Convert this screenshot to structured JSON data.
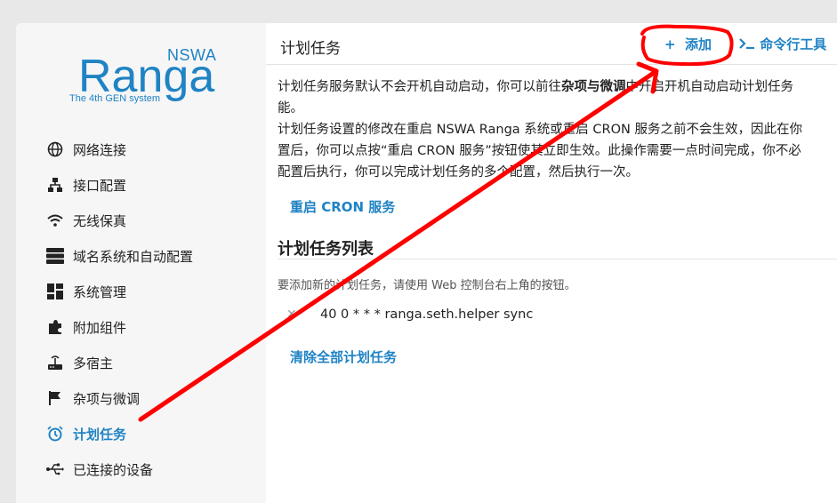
{
  "brand": {
    "name": "Ranga",
    "prefix": "NSWA",
    "tagline": "The 4th GEN system"
  },
  "sidebar": {
    "items": [
      {
        "label": "网络连接",
        "icon": "globe-icon"
      },
      {
        "label": "接口配置",
        "icon": "network-icon"
      },
      {
        "label": "无线保真",
        "icon": "wifi-icon"
      },
      {
        "label": "域名系统和自动配置",
        "icon": "server-icon"
      },
      {
        "label": "系统管理",
        "icon": "dashboard-icon"
      },
      {
        "label": "附加组件",
        "icon": "puzzle-icon"
      },
      {
        "label": "多宿主",
        "icon": "router-icon"
      },
      {
        "label": "杂项与微调",
        "icon": "flag-icon"
      },
      {
        "label": "计划任务",
        "icon": "alarm-clock-icon",
        "active": true
      },
      {
        "label": "已连接的设备",
        "icon": "usb-icon"
      }
    ]
  },
  "header": {
    "title": "计划任务",
    "add_label": "添加",
    "cli_label": "命令行工具"
  },
  "description": {
    "line1_a": "计划任务服务默认不会开机自动启动，你可以前往",
    "line1_bold": "杂项与微调",
    "line1_b": "中开启开机自动启动计划任务",
    "line2": "能。",
    "line3": "计划任务设置的修改在重启 NSWA Ranga 系统或重启 CRON 服务之前不会生效，因此在你",
    "line4": "置后，你可以点按“重启 CRON 服务”按钮使其立即生效。此操作需要一点时间完成，你不必",
    "line5": "配置后执行，你可以完成计划任务的多个配置，然后执行一次。"
  },
  "restart_button": "重启 CRON 服务",
  "task_list": {
    "title": "计划任务列表",
    "hint": "要添加新的计划任务，请使用 Web 控制台右上角的按钮。",
    "tasks": [
      "40 0 * * * ranga.seth.helper sync"
    ],
    "clear_button": "清除全部计划任务"
  },
  "colors": {
    "accent": "#1f83c4",
    "annotation": "#ff0000"
  }
}
